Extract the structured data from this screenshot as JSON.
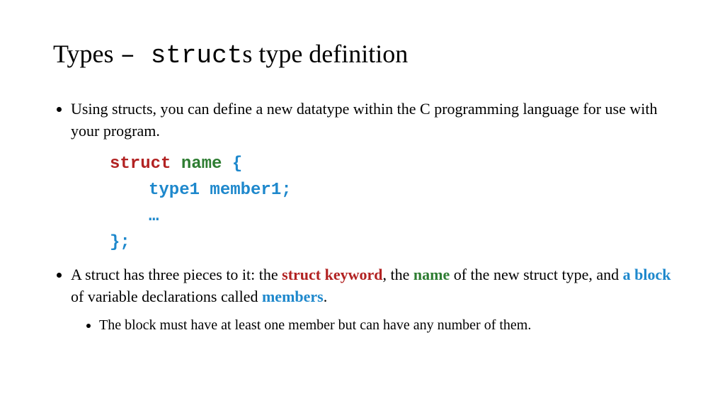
{
  "title": {
    "part1": "Types ",
    "dash": "– ",
    "code": "struct",
    "part2": "s type definition"
  },
  "bullet1": "Using structs, you can define a new datatype within the C programming language for use with your program.",
  "code": {
    "line1_struct": "struct",
    "line1_name": "name",
    "line1_brace": "{",
    "line2": "type1 member1;",
    "line3": "…",
    "line4": "};"
  },
  "bullet2": {
    "p1": "A struct has three pieces to it: the ",
    "struct_keyword": "struct keyword",
    "p2": ", the ",
    "name": "name",
    "p3": " of the new struct type, and ",
    "a_block": "a block",
    "p4": " of variable declarations called ",
    "members": "members",
    "p5": "."
  },
  "subbullet": "The block must have at least one member but can have any number of them."
}
